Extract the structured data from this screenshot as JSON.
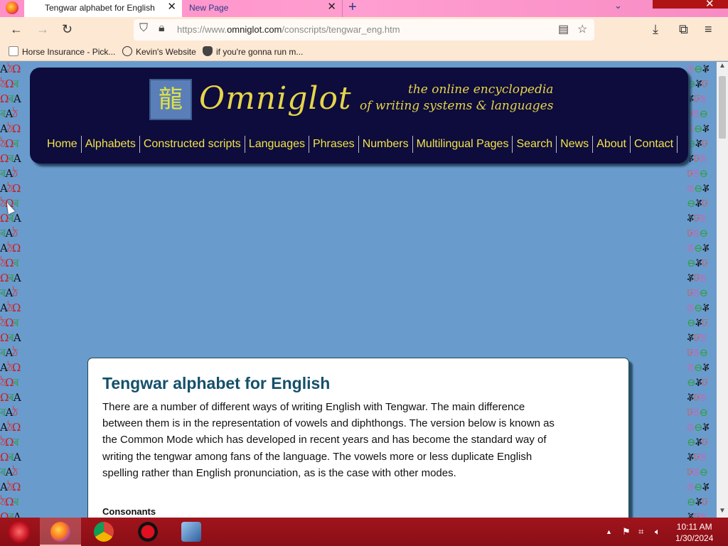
{
  "browser": {
    "tabs": [
      {
        "title": "Tengwar alphabet for English",
        "active": true
      },
      {
        "title": "New Page",
        "active": false
      }
    ],
    "url_prefix": "https://www.",
    "url_domain": "omniglot.com",
    "url_path": "/conscripts/tengwar_eng.htm",
    "bookmarks": [
      {
        "label": "Horse Insurance - Pick...",
        "icon": "page-icon"
      },
      {
        "label": "Kevin's Website",
        "icon": "globe-icon"
      },
      {
        "label": "if you're gonna run m...",
        "icon": "mask-icon"
      }
    ],
    "colors": {
      "tabbar": "#ff9ed0",
      "toolbar": "#fde8d3"
    }
  },
  "site": {
    "logo_glyph": "龍",
    "title": "Omniglot",
    "tagline_line1": "the online encyclopedia",
    "tagline_line2": "of writing systems & languages",
    "nav": [
      "Home",
      "Alphabets",
      "Constructed scripts",
      "Languages",
      "Phrases",
      "Numbers",
      "Multilingual Pages",
      "Search",
      "News",
      "About",
      "Contact"
    ],
    "colors": {
      "header_bg": "#0d0c3c",
      "nav_text": "#f3e34a",
      "page_bg": "#6a9bcd"
    }
  },
  "article": {
    "title": "Tengwar alphabet for English",
    "paragraph": "There are a number of different ways of writing English with Tengwar. The main difference between them is in the representation of vowels and diphthongs. The version below is known as the Common Mode which has developed in recent years and has become the standard way of writing the tengwar among fans of the language. The vowels more or less duplicate English spelling rather than English pronunciation, as is the case with other modes.",
    "section_heading": "Consonants"
  },
  "taskbar": {
    "apps": [
      {
        "name": "Firefox",
        "icon": "firefox-icon",
        "active": true
      },
      {
        "name": "Chrome",
        "icon": "chrome-icon",
        "active": false
      },
      {
        "name": "Recorder",
        "icon": "record-icon",
        "active": false
      },
      {
        "name": "VirtualBox",
        "icon": "virtualbox-icon",
        "active": false
      }
    ],
    "time": "10:11 AM",
    "date": "1/30/2024"
  }
}
